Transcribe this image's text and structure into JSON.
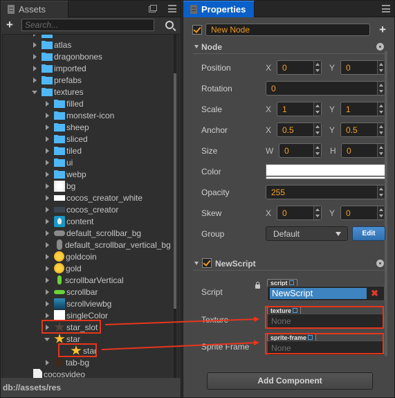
{
  "assets_panel": {
    "tab_label": "Assets",
    "search_placeholder": "Search...",
    "status_path": "db://assets/res",
    "tree": [
      {
        "label": "atlas",
        "icon": "folder",
        "arrow": "right",
        "level": 0
      },
      {
        "label": "dragonbones",
        "icon": "folder",
        "arrow": "right",
        "level": 0
      },
      {
        "label": "imported",
        "icon": "folder",
        "arrow": "right",
        "level": 0
      },
      {
        "label": "prefabs",
        "icon": "folder",
        "arrow": "right",
        "level": 0
      },
      {
        "label": "textures",
        "icon": "folder",
        "arrow": "down",
        "level": 0
      },
      {
        "label": "filled",
        "icon": "folder",
        "arrow": "right",
        "level": 1
      },
      {
        "label": "monster-icon",
        "icon": "folder",
        "arrow": "right",
        "level": 1
      },
      {
        "label": "sheep",
        "icon": "folder",
        "arrow": "right",
        "level": 1
      },
      {
        "label": "sliced",
        "icon": "folder",
        "arrow": "right",
        "level": 1
      },
      {
        "label": "tiled",
        "icon": "folder",
        "arrow": "right",
        "level": 1
      },
      {
        "label": "ui",
        "icon": "folder",
        "arrow": "right",
        "level": 1
      },
      {
        "label": "webp",
        "icon": "folder",
        "arrow": "right",
        "level": 1
      },
      {
        "label": "bg",
        "icon": "img-bg",
        "arrow": "right",
        "level": 1
      },
      {
        "label": "cocos_creator_white",
        "icon": "img-logo-white",
        "arrow": "right",
        "level": 1
      },
      {
        "label": "cocos_creator",
        "icon": "img-logo-dark",
        "arrow": "right",
        "level": 1
      },
      {
        "label": "content",
        "icon": "img-content",
        "arrow": "right",
        "level": 1
      },
      {
        "label": "default_scrollbar_bg",
        "icon": "img-pill-h",
        "arrow": "right",
        "level": 1
      },
      {
        "label": "default_scrollbar_vertical_bg",
        "icon": "img-pill-v",
        "arrow": "right",
        "level": 1
      },
      {
        "label": "goldcoin",
        "icon": "img-coin",
        "arrow": "right",
        "level": 1
      },
      {
        "label": "gold",
        "icon": "img-coin",
        "arrow": "right",
        "level": 1
      },
      {
        "label": "scrollbarVertical",
        "icon": "img-gpill-v",
        "arrow": "right",
        "level": 1
      },
      {
        "label": "scrollbar",
        "icon": "img-gpill-h",
        "arrow": "right",
        "level": 1
      },
      {
        "label": "scrollviewbg",
        "icon": "img-sv",
        "arrow": "right",
        "level": 1
      },
      {
        "label": "singleColor",
        "icon": "img-white",
        "arrow": "right",
        "level": 1
      },
      {
        "label": "star_slot",
        "icon": "star-dark",
        "arrow": "right",
        "level": 1,
        "highlighted": true
      },
      {
        "label": "star",
        "icon": "star-gold",
        "arrow": "down",
        "level": 1
      },
      {
        "label": "star",
        "icon": "star-gold",
        "arrow": "none",
        "level": 2,
        "highlighted": true
      },
      {
        "label": "tab-bg",
        "icon": "img-tabbg",
        "arrow": "right",
        "level": 1
      },
      {
        "label": "cocosvideo",
        "icon": "img-doc",
        "arrow": "none",
        "level": 0
      }
    ]
  },
  "properties_panel": {
    "tab_label": "Properties",
    "node_enabled": true,
    "node_name": "New Node",
    "node_section": {
      "title": "Node",
      "position": {
        "label": "Position",
        "x_label": "X",
        "x": "0",
        "y_label": "Y",
        "y": "0"
      },
      "rotation": {
        "label": "Rotation",
        "value": "0"
      },
      "scale": {
        "label": "Scale",
        "x_label": "X",
        "x": "1",
        "y_label": "Y",
        "y": "1"
      },
      "anchor": {
        "label": "Anchor",
        "x_label": "X",
        "x": "0.5",
        "y_label": "Y",
        "y": "0.5"
      },
      "size": {
        "label": "Size",
        "w_label": "W",
        "w": "0",
        "h_label": "H",
        "h": "0"
      },
      "color": {
        "label": "Color",
        "value": "#ffffff"
      },
      "opacity": {
        "label": "Opacity",
        "value": "255"
      },
      "skew": {
        "label": "Skew",
        "x_label": "X",
        "x": "0",
        "y_label": "Y",
        "y": "0"
      },
      "group": {
        "label": "Group",
        "value": "Default",
        "edit_label": "Edit"
      }
    },
    "script_section": {
      "title": "NewScript",
      "enabled": true,
      "script": {
        "label": "Script",
        "tag": "script",
        "value": "NewScript"
      },
      "texture": {
        "label": "Texture",
        "tag": "texture",
        "value": "None"
      },
      "sprite_frame": {
        "label": "Sprite Frame",
        "tag": "sprite-frame",
        "value": "None"
      }
    },
    "add_component_label": "Add Component"
  },
  "annotation_color": "#e8361c"
}
